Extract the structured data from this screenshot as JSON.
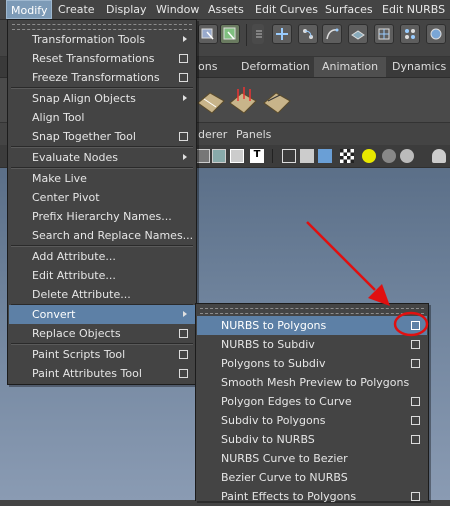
{
  "menubar": {
    "items": [
      "Modify",
      "Create",
      "Display",
      "Window",
      "Assets",
      "Edit Curves",
      "Surfaces",
      "Edit NURBS"
    ]
  },
  "shelf_tabs": [
    "ons",
    "Deformation",
    "Animation",
    "Dynamics"
  ],
  "panel_menus": [
    "derer",
    "Panels"
  ],
  "modify_menu": {
    "items": [
      "Transformation Tools",
      "Reset Transformations",
      "Freeze Transformations",
      "Snap Align Objects",
      "Align Tool",
      "Snap Together Tool",
      "Evaluate Nodes",
      "Make Live",
      "Center Pivot",
      "Prefix Hierarchy Names...",
      "Search and Replace Names...",
      "Add Attribute...",
      "Edit Attribute...",
      "Delete Attribute...",
      "Convert",
      "Replace Objects",
      "Paint Scripts Tool",
      "Paint Attributes Tool"
    ]
  },
  "convert_menu": {
    "items": [
      "NURBS to Polygons",
      "NURBS to Subdiv",
      "Polygons to Subdiv",
      "Smooth Mesh Preview to Polygons",
      "Polygon Edges to Curve",
      "Subdiv to Polygons",
      "Subdiv to NURBS",
      "NURBS Curve to Bezier",
      "Bezier Curve to NURBS",
      "Paint Effects to Polygons"
    ]
  },
  "colors": {
    "menu_bg": "#444444",
    "highlight": "#5d80a6",
    "annotation": "#e01010",
    "viewport_top": "#5b6f88"
  },
  "annotation": {
    "description_icons": [
      "red-arrow",
      "red-circle"
    ]
  }
}
